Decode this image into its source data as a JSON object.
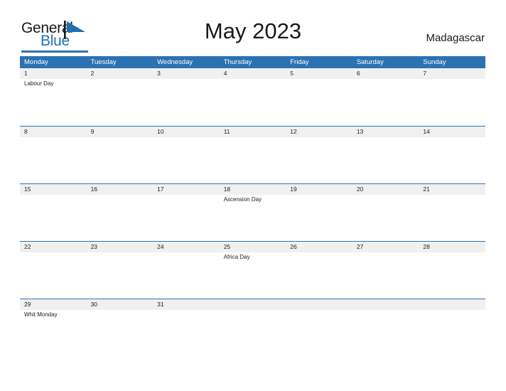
{
  "logo": {
    "word_one": "General",
    "word_two": "Blue",
    "flag_icon": "flag-triangle-icon",
    "accent_color": "#2b72b3"
  },
  "header": {
    "title": "May 2023",
    "country": "Madagascar"
  },
  "calendar": {
    "header_background": "#2b72b3",
    "date_band_background": "#f0f0f0",
    "weekdays": [
      "Monday",
      "Tuesday",
      "Wednesday",
      "Thursday",
      "Friday",
      "Saturday",
      "Sunday"
    ],
    "weeks": [
      [
        {
          "date": "1",
          "event": "Labour Day"
        },
        {
          "date": "2",
          "event": ""
        },
        {
          "date": "3",
          "event": ""
        },
        {
          "date": "4",
          "event": ""
        },
        {
          "date": "5",
          "event": ""
        },
        {
          "date": "6",
          "event": ""
        },
        {
          "date": "7",
          "event": ""
        }
      ],
      [
        {
          "date": "8",
          "event": ""
        },
        {
          "date": "9",
          "event": ""
        },
        {
          "date": "10",
          "event": ""
        },
        {
          "date": "11",
          "event": ""
        },
        {
          "date": "12",
          "event": ""
        },
        {
          "date": "13",
          "event": ""
        },
        {
          "date": "14",
          "event": ""
        }
      ],
      [
        {
          "date": "15",
          "event": ""
        },
        {
          "date": "16",
          "event": ""
        },
        {
          "date": "17",
          "event": ""
        },
        {
          "date": "18",
          "event": "Ascension Day"
        },
        {
          "date": "19",
          "event": ""
        },
        {
          "date": "20",
          "event": ""
        },
        {
          "date": "21",
          "event": ""
        }
      ],
      [
        {
          "date": "22",
          "event": ""
        },
        {
          "date": "23",
          "event": ""
        },
        {
          "date": "24",
          "event": ""
        },
        {
          "date": "25",
          "event": "Africa Day"
        },
        {
          "date": "26",
          "event": ""
        },
        {
          "date": "27",
          "event": ""
        },
        {
          "date": "28",
          "event": ""
        }
      ],
      [
        {
          "date": "29",
          "event": "Whit Monday"
        },
        {
          "date": "30",
          "event": ""
        },
        {
          "date": "31",
          "event": ""
        },
        {
          "date": "",
          "event": ""
        },
        {
          "date": "",
          "event": ""
        },
        {
          "date": "",
          "event": ""
        },
        {
          "date": "",
          "event": ""
        }
      ]
    ]
  }
}
